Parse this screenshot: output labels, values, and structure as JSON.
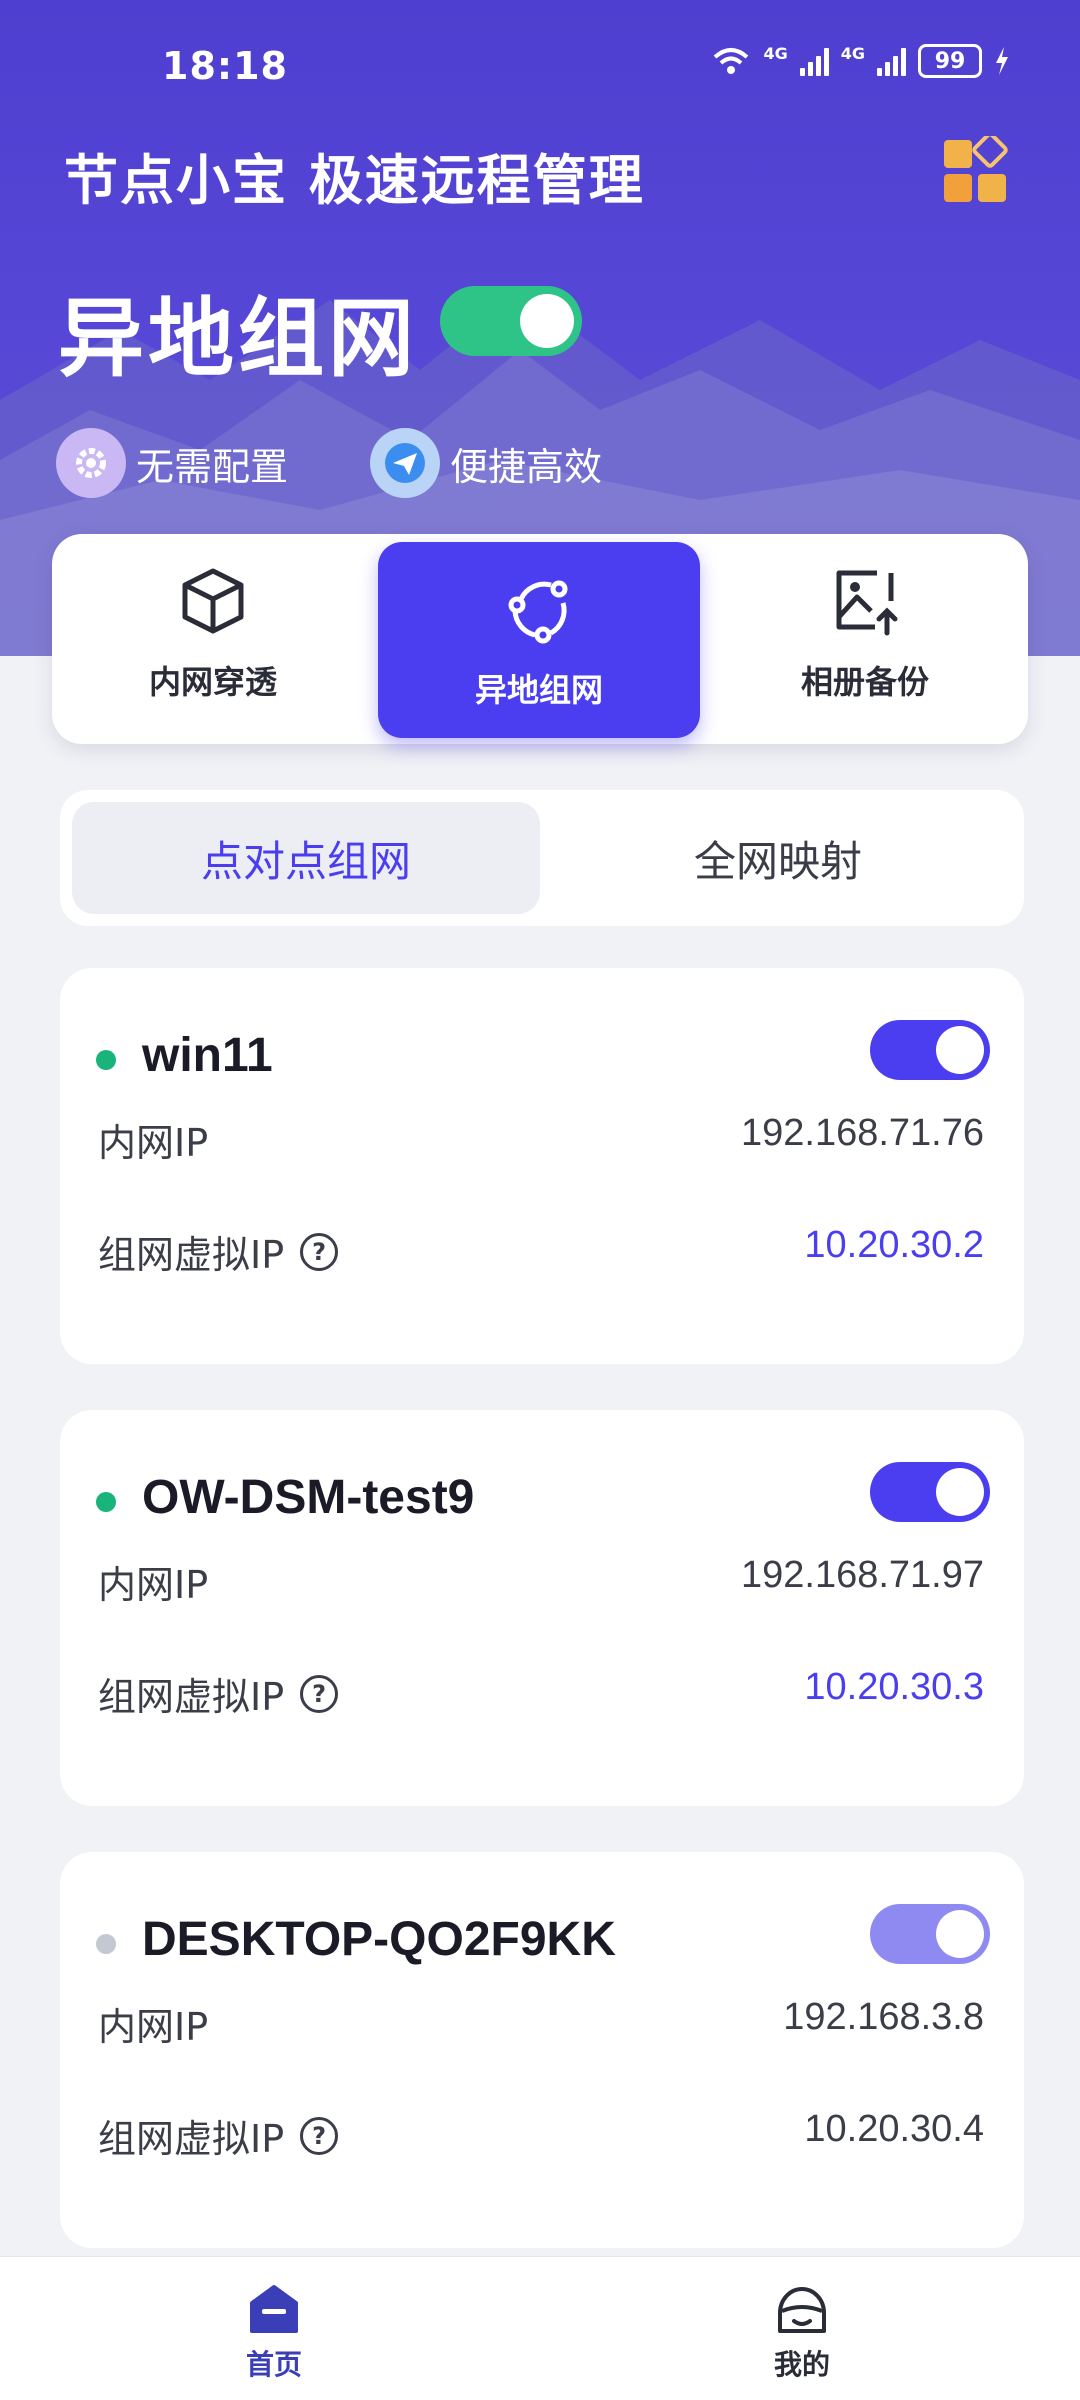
{
  "status_bar": {
    "time": "18:18",
    "signal1_label": "4G",
    "signal2_label": "4G",
    "battery": "99"
  },
  "header": {
    "app_title": "节点小宝 极速远程管理",
    "feature_title": "异地组网",
    "feature_enabled": true,
    "tags": [
      {
        "label": "无需配置",
        "icon": "gear-icon"
      },
      {
        "label": "便捷高效",
        "icon": "paper-plane-icon"
      }
    ]
  },
  "mode_tabs": [
    {
      "label": "内网穿透",
      "icon": "cube-icon",
      "active": false
    },
    {
      "label": "异地组网",
      "icon": "network-nodes-icon",
      "active": true
    },
    {
      "label": "相册备份",
      "icon": "image-upload-icon",
      "active": false
    }
  ],
  "segments": [
    {
      "label": "点对点组网",
      "active": true
    },
    {
      "label": "全网映射",
      "active": false
    }
  ],
  "devices": [
    {
      "name": "win11",
      "online": true,
      "enabled": true,
      "lan_ip_label": "内网IP",
      "lan_ip": "192.168.71.76",
      "vip_label": "组网虚拟IP",
      "vip": "10.20.30.2"
    },
    {
      "name": "OW-DSM-test9",
      "online": true,
      "enabled": true,
      "lan_ip_label": "内网IP",
      "lan_ip": "192.168.71.97",
      "vip_label": "组网虚拟IP",
      "vip": "10.20.30.3"
    },
    {
      "name": "DESKTOP-QO2F9KK",
      "online": false,
      "enabled": true,
      "lan_ip_label": "内网IP",
      "lan_ip": "192.168.3.8",
      "vip_label": "组网虚拟IP",
      "vip": "10.20.30.4"
    }
  ],
  "colors": {
    "accent": "#4a3ef0",
    "online": "#18b47b",
    "offline": "#c4c8d2",
    "toggle_on": "#4a3ef0",
    "toggle_disabled": "#8f89f2",
    "vip_active": "#4a3ef0",
    "vip_inactive": "#3b3d48"
  },
  "bottom_nav": [
    {
      "label": "首页",
      "icon": "home-icon",
      "active": true
    },
    {
      "label": "我的",
      "icon": "user-face-icon",
      "active": false
    }
  ]
}
